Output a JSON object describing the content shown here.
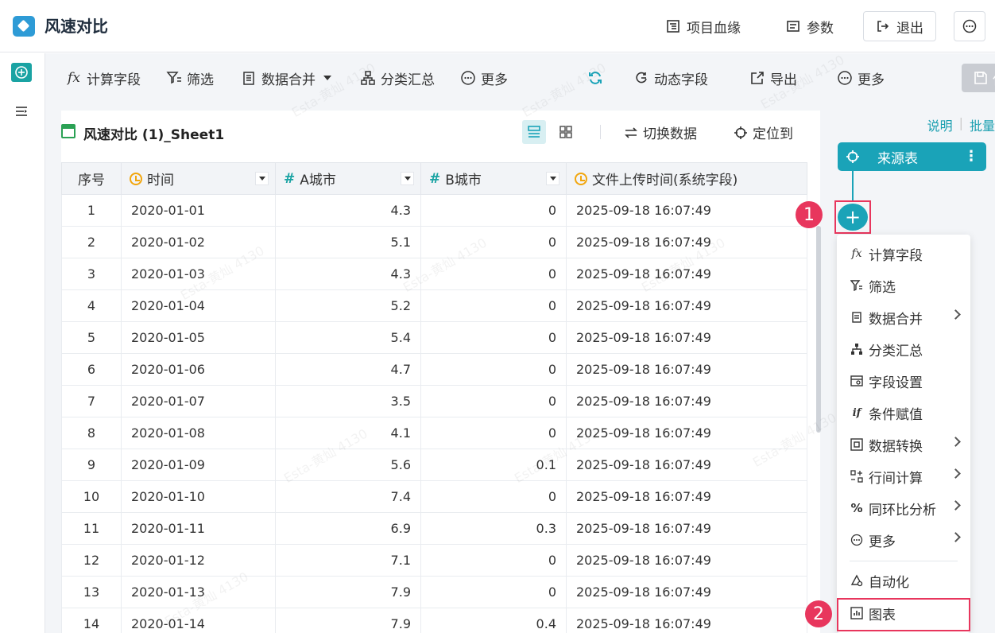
{
  "header": {
    "title": "风速对比",
    "lineage_label": "项目血缘",
    "params_label": "参数",
    "exit_label": "退出"
  },
  "toolbar": {
    "calc_field": "计算字段",
    "filter": "筛选",
    "merge": "数据合并",
    "group_summary": "分类汇总",
    "more": "更多",
    "dynamic_field": "动态字段",
    "export": "导出",
    "more_right": "更多",
    "save": "保存"
  },
  "sheet": {
    "title": "风速对比 (1)_Sheet1",
    "switch_data": "切换数据",
    "locate": "定位到"
  },
  "table": {
    "columns": [
      "序号",
      "时间",
      "A城市",
      "B城市",
      "文件上传时间(系统字段)"
    ],
    "rows": [
      [
        "1",
        "2020-01-01",
        "4.3",
        "0",
        "2025-09-18 16:07:49"
      ],
      [
        "2",
        "2020-01-02",
        "5.1",
        "0",
        "2025-09-18 16:07:49"
      ],
      [
        "3",
        "2020-01-03",
        "4.3",
        "0",
        "2025-09-18 16:07:49"
      ],
      [
        "4",
        "2020-01-04",
        "5.2",
        "0",
        "2025-09-18 16:07:49"
      ],
      [
        "5",
        "2020-01-05",
        "5.4",
        "0",
        "2025-09-18 16:07:49"
      ],
      [
        "6",
        "2020-01-06",
        "4.7",
        "0",
        "2025-09-18 16:07:49"
      ],
      [
        "7",
        "2020-01-07",
        "3.5",
        "0",
        "2025-09-18 16:07:49"
      ],
      [
        "8",
        "2020-01-08",
        "4.1",
        "0",
        "2025-09-18 16:07:49"
      ],
      [
        "9",
        "2020-01-09",
        "5.6",
        "0.1",
        "2025-09-18 16:07:49"
      ],
      [
        "10",
        "2020-01-10",
        "7.4",
        "0",
        "2025-09-18 16:07:49"
      ],
      [
        "11",
        "2020-01-11",
        "6.9",
        "0.3",
        "2025-09-18 16:07:49"
      ],
      [
        "12",
        "2020-01-12",
        "7.1",
        "0",
        "2025-09-18 16:07:49"
      ],
      [
        "13",
        "2020-01-13",
        "7.9",
        "0",
        "2025-09-18 16:07:49"
      ],
      [
        "14",
        "2020-01-14",
        "7.9",
        "0.4",
        "2025-09-18 16:07:49"
      ]
    ]
  },
  "flow": {
    "help_link": "说明",
    "batch_link": "批量",
    "source_node": "来源表",
    "badge_1": "1",
    "badge_2": "2",
    "menu": [
      {
        "label": "计算字段",
        "icon": "fx-icon",
        "submenu": false
      },
      {
        "label": "筛选",
        "icon": "filter-icon",
        "submenu": false
      },
      {
        "label": "数据合并",
        "icon": "merge-icon",
        "submenu": true
      },
      {
        "label": "分类汇总",
        "icon": "hierarchy-icon",
        "submenu": false
      },
      {
        "label": "字段设置",
        "icon": "field-settings-icon",
        "submenu": false
      },
      {
        "label": "条件赋值",
        "icon": "if-icon",
        "submenu": false
      },
      {
        "label": "数据转换",
        "icon": "transform-icon",
        "submenu": true
      },
      {
        "label": "行间计算",
        "icon": "row-calc-icon",
        "submenu": true
      },
      {
        "label": "同环比分析",
        "icon": "percent-icon",
        "submenu": true
      },
      {
        "label": "更多",
        "icon": "more-icon",
        "submenu": true
      },
      {
        "label": "自动化",
        "icon": "automation-icon",
        "submenu": false
      },
      {
        "label": "图表",
        "icon": "chart-icon",
        "submenu": false
      }
    ]
  },
  "watermark": "Esta-黄灿 4130"
}
